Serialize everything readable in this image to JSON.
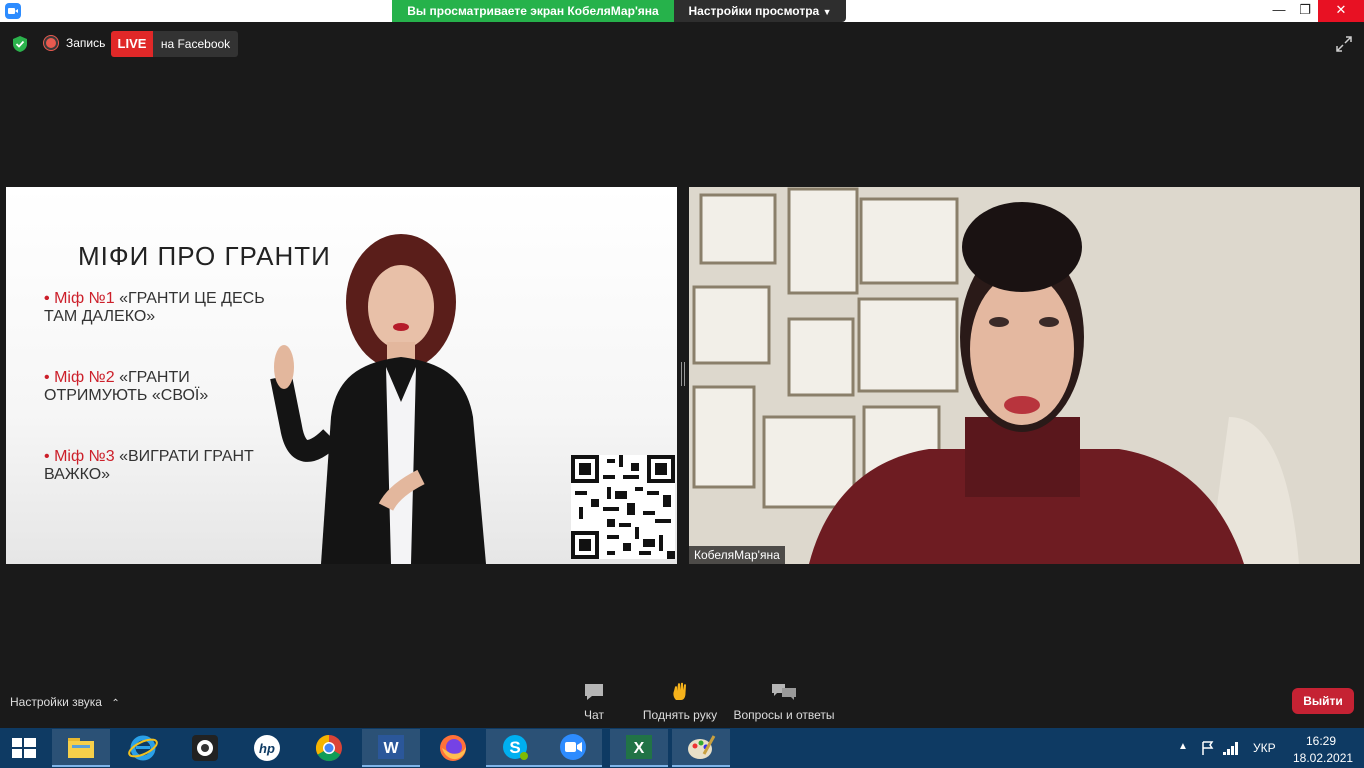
{
  "titlebar": {
    "share_banner": "Вы просматриваете экран КобеляМар'яна",
    "view_options": "Настройки просмотра",
    "minimize": "—",
    "restore": "❐",
    "close": "✕"
  },
  "status": {
    "recording_label": "Запись",
    "live_badge": "LIVE",
    "live_destination": "на Facebook"
  },
  "slide": {
    "title": "МІФИ ПРО ГРАНТИ",
    "bullet": "•",
    "myths": [
      {
        "number": "Міф №1",
        "line1": " «ГРАНТИ ЦЕ ДЕСЬ",
        "line2": "ТАМ ДАЛЕКО»"
      },
      {
        "number": "Міф №2",
        "line1": " «ГРАНТИ",
        "line2": "ОТРИМУЮТЬ «СВОЇ»"
      },
      {
        "number": "Міф №3",
        "line1": " «ВИГРАТИ ГРАНТ",
        "line2": "ВАЖКО»"
      }
    ]
  },
  "video": {
    "participant_name": "КобеляМар'яна"
  },
  "toolbar": {
    "audio_settings": "Настройки звука",
    "chat": "Чат",
    "raise_hand": "Поднять руку",
    "qa": "Вопросы и ответы",
    "leave": "Выйти"
  },
  "taskbar": {
    "apps": [
      "file-explorer",
      "internet-explorer",
      "webcam",
      "hp",
      "chrome",
      "word",
      "firefox",
      "skype",
      "zoom",
      "excel",
      "paint"
    ],
    "language": "УКР",
    "time": "16:29",
    "date": "18.02.2021"
  },
  "colors": {
    "accent_red": "#cc1f2a",
    "share_green": "#26b24b",
    "leave_red": "#c52233",
    "taskbar": "#0e3a63"
  }
}
